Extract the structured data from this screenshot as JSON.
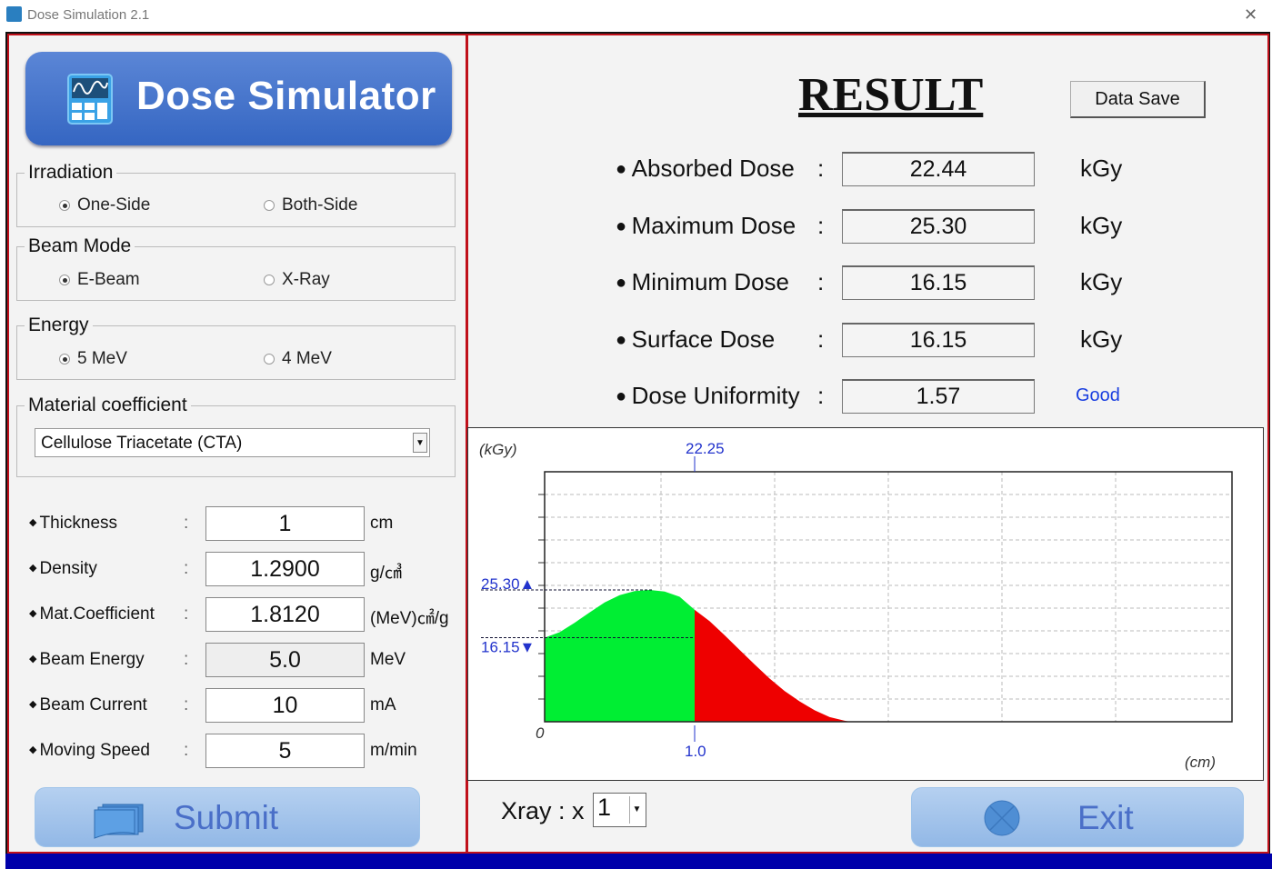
{
  "window": {
    "title": "Dose Simulation 2.1",
    "close_icon": "close-icon"
  },
  "banner": {
    "title": "Dose Simulator",
    "icon": "calculator-wave-icon"
  },
  "irradiation": {
    "label": "Irradiation",
    "options": [
      "One-Side",
      "Both-Side"
    ],
    "selected": "One-Side"
  },
  "beam_mode": {
    "label": "Beam Mode",
    "options": [
      "E-Beam",
      "X-Ray"
    ],
    "selected": "E-Beam"
  },
  "energy": {
    "label": "Energy",
    "options": [
      "5 MeV",
      "4 MeV"
    ],
    "selected": "5 MeV"
  },
  "material": {
    "label": "Material coefficient",
    "selected": "Cellulose Triacetate (CTA)"
  },
  "params": [
    {
      "label": "Thickness",
      "value": "1",
      "unit": "cm",
      "readonly": false
    },
    {
      "label": "Density",
      "value": "1.2900",
      "unit": "g/㎤",
      "readonly": false
    },
    {
      "label": "Mat.Coefficient",
      "value": "1.8120",
      "unit": "(MeV)㎠/g",
      "readonly": false
    },
    {
      "label": "Beam Energy",
      "value": "5.0",
      "unit": "MeV",
      "readonly": true
    },
    {
      "label": "Beam Current",
      "value": "10",
      "unit": "mA",
      "readonly": false
    },
    {
      "label": "Moving Speed",
      "value": "5",
      "unit": "m/min",
      "readonly": false
    }
  ],
  "colon": ":",
  "submit": {
    "label": "Submit",
    "icon": "stacked-windows-icon"
  },
  "result": {
    "title": "RESULT",
    "save_label": "Data Save",
    "rows": [
      {
        "label": "Absorbed Dose",
        "value": "22.44",
        "unit": "kGy"
      },
      {
        "label": "Maximum Dose",
        "value": "25.30",
        "unit": "kGy"
      },
      {
        "label": "Minimum Dose",
        "value": "16.15",
        "unit": "kGy"
      },
      {
        "label": "Surface Dose",
        "value": "16.15",
        "unit": "kGy"
      },
      {
        "label": "Dose Uniformity",
        "value": "1.57",
        "unit": "Good"
      }
    ],
    "good_color": "#1a3fe0"
  },
  "xray": {
    "label": "Xray : x",
    "value": "1"
  },
  "exit": {
    "label": "Exit",
    "icon": "close-circle-icon"
  },
  "chart_data": {
    "type": "area",
    "ylabel": "(kGy)",
    "xlabel": "(cm)",
    "origin_label": "0",
    "ylim": [
      0,
      48
    ],
    "xlim": [
      0,
      4.6
    ],
    "grid": true,
    "x": [
      0,
      0.1,
      0.2,
      0.3,
      0.4,
      0.5,
      0.6,
      0.7,
      0.8,
      0.9,
      1.0,
      1.1,
      1.2,
      1.3,
      1.4,
      1.5,
      1.6,
      1.7,
      1.8,
      1.9,
      2.0,
      2.04
    ],
    "y": [
      16.15,
      17.2,
      19.0,
      21.0,
      22.9,
      24.3,
      25.1,
      25.3,
      25.0,
      24.0,
      21.5,
      19.3,
      16.6,
      13.8,
      11.0,
      8.3,
      5.9,
      3.9,
      2.2,
      0.9,
      0.2,
      0
    ],
    "threshold_x": 1.0,
    "threshold_label": "1.0",
    "mean_label": "22.25",
    "max_value": 25.3,
    "max_label": "25.30",
    "min_value": 16.15,
    "min_label": "16.15",
    "colors": {
      "inside": "#00ee33",
      "outside": "#ee0000",
      "annotation": "#2233cc"
    }
  }
}
